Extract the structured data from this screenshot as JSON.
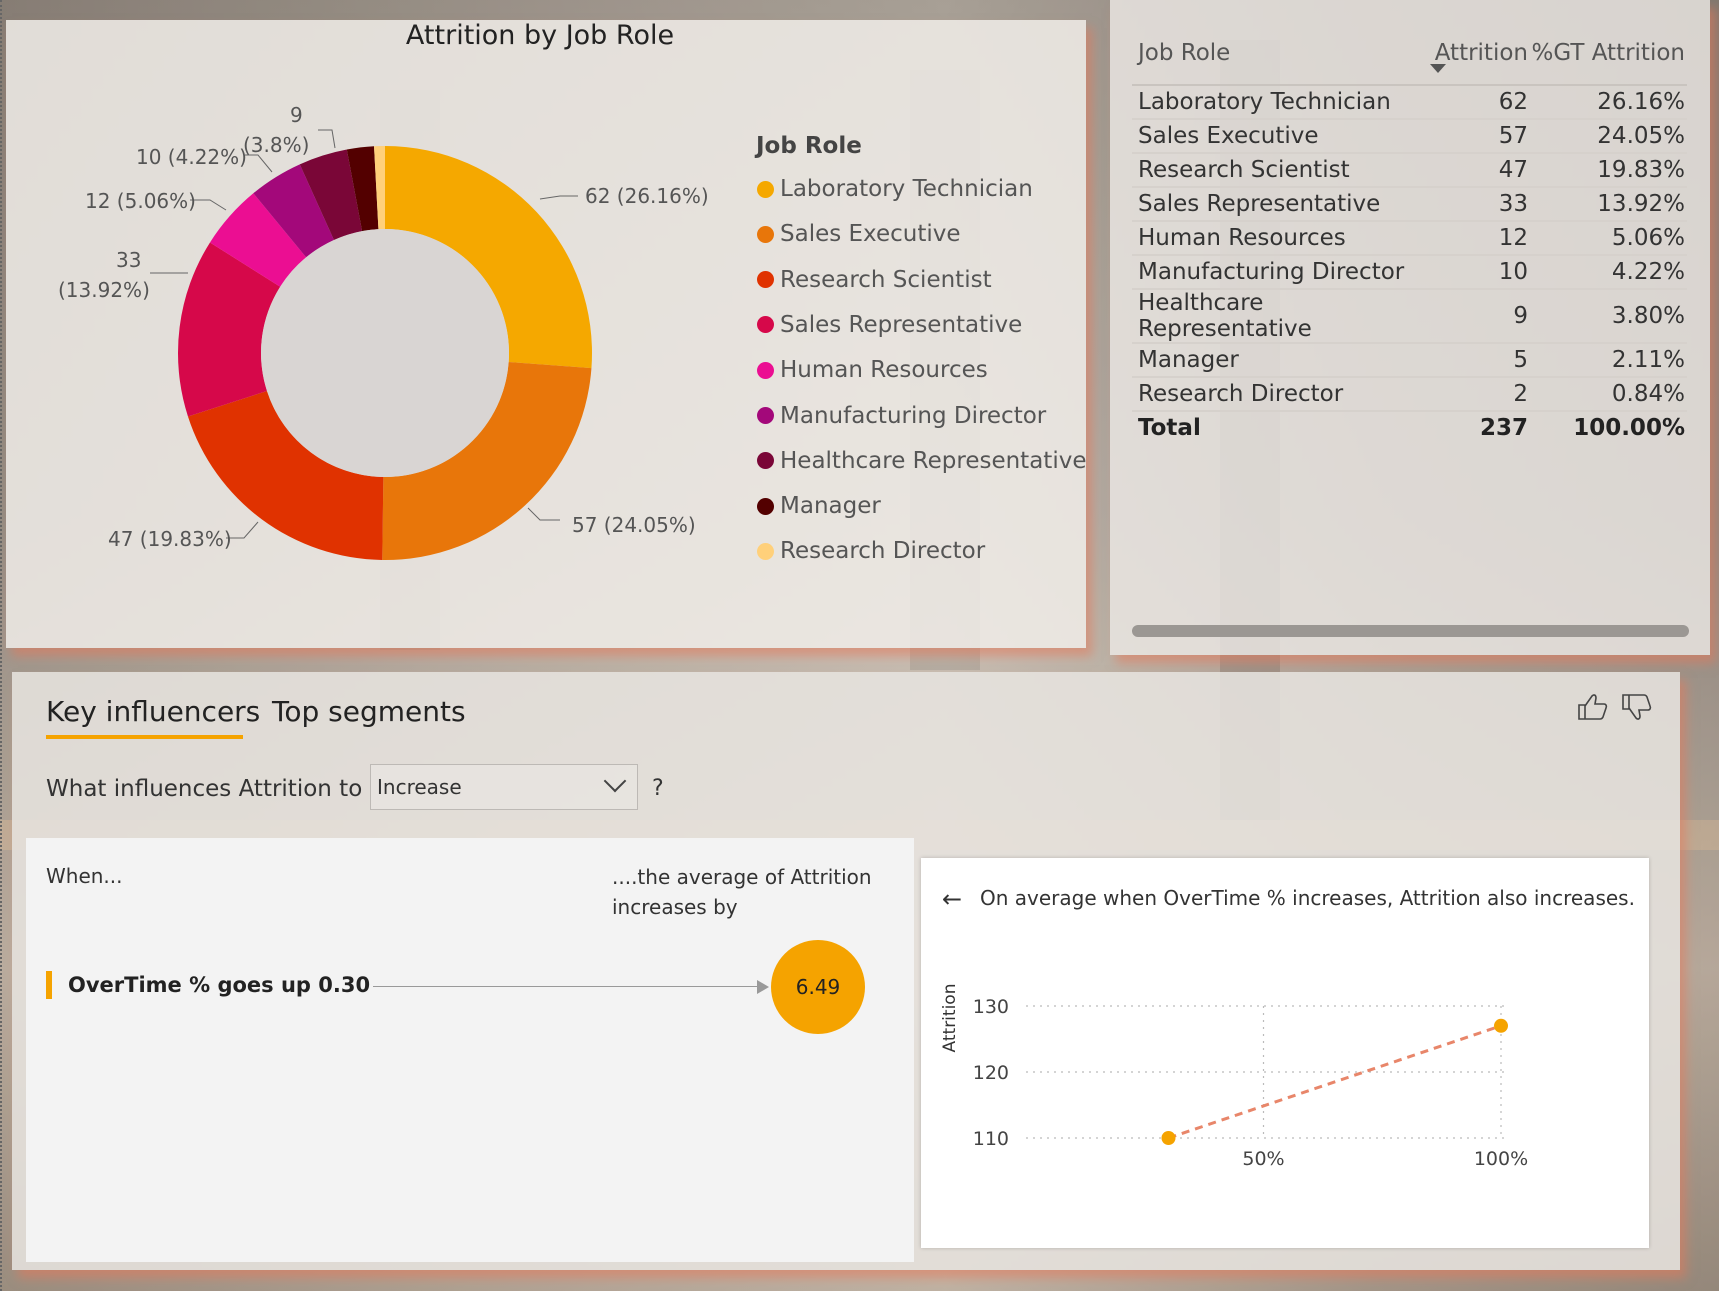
{
  "donut": {
    "title": "Attrition by Job Role",
    "legend_title": "Job Role",
    "slice_labels": {
      "lab_tech": "62 (26.16%)",
      "sales_exec": "57 (24.05%)",
      "research_sci": "47 (19.83%)",
      "sales_rep_count": "33",
      "sales_rep_pct": "(13.92%)",
      "hr": "12 (5.06%)",
      "mfg_dir": "10 (4.22%)",
      "health_count": "9",
      "health_pct": "(3.8%)"
    }
  },
  "chart_data": {
    "type": "pie",
    "title": "Attrition by Job Role",
    "legend_title": "Job Role",
    "categories": [
      "Laboratory Technician",
      "Sales Executive",
      "Research Scientist",
      "Sales Representative",
      "Human Resources",
      "Manufacturing Director",
      "Healthcare Representative",
      "Manager",
      "Research Director"
    ],
    "values": [
      62,
      57,
      47,
      33,
      12,
      10,
      9,
      5,
      2
    ],
    "colors": [
      "#F5A800",
      "#E8760A",
      "#E03200",
      "#D6084A",
      "#EB0E92",
      "#A3087A",
      "#7A0637",
      "#530000",
      "#FFD07A"
    ],
    "legend_position": "right",
    "donut": true
  },
  "table": {
    "headers": [
      "Job Role",
      "Attrition",
      "%GT Attrition"
    ],
    "rows": [
      [
        "Laboratory Technician",
        "62",
        "26.16%"
      ],
      [
        "Sales Executive",
        "57",
        "24.05%"
      ],
      [
        "Research Scientist",
        "47",
        "19.83%"
      ],
      [
        "Sales Representative",
        "33",
        "13.92%"
      ],
      [
        "Human Resources",
        "12",
        "5.06%"
      ],
      [
        "Manufacturing Director",
        "10",
        "4.22%"
      ],
      [
        "Healthcare Representative",
        "9",
        "3.80%"
      ],
      [
        "Manager",
        "5",
        "2.11%"
      ],
      [
        "Research Director",
        "2",
        "0.84%"
      ]
    ],
    "total": [
      "Total",
      "237",
      "100.00%"
    ]
  },
  "key_influencers": {
    "tabs": [
      "Key influencers",
      "Top segments"
    ],
    "active_tab": "Key influencers",
    "question": "What influences Attrition to",
    "dropdown_value": "Increase",
    "help": "?",
    "when_label": "When...",
    "avg_label_line1": "....the average of Attrition",
    "avg_label_line2": "increases by",
    "influencer_text": "OverTime % goes up 0.30",
    "influencer_value": "6.49",
    "detail_text": "On average when OverTime % increases, Attrition also increases.",
    "accent": "#F5A300"
  },
  "detail_chart": {
    "type": "line",
    "ylabel": "Attrition",
    "y_ticks": [
      "130",
      "120",
      "110"
    ],
    "x_ticks": [
      "50%",
      "100%"
    ],
    "ylim": [
      110,
      130
    ],
    "xlim": [
      0.0,
      1.0
    ],
    "points": [
      {
        "x": 0.3,
        "y": 110
      },
      {
        "x": 1.0,
        "y": 127
      }
    ],
    "line_color": "#E8866A",
    "point_color": "#F5A300"
  }
}
